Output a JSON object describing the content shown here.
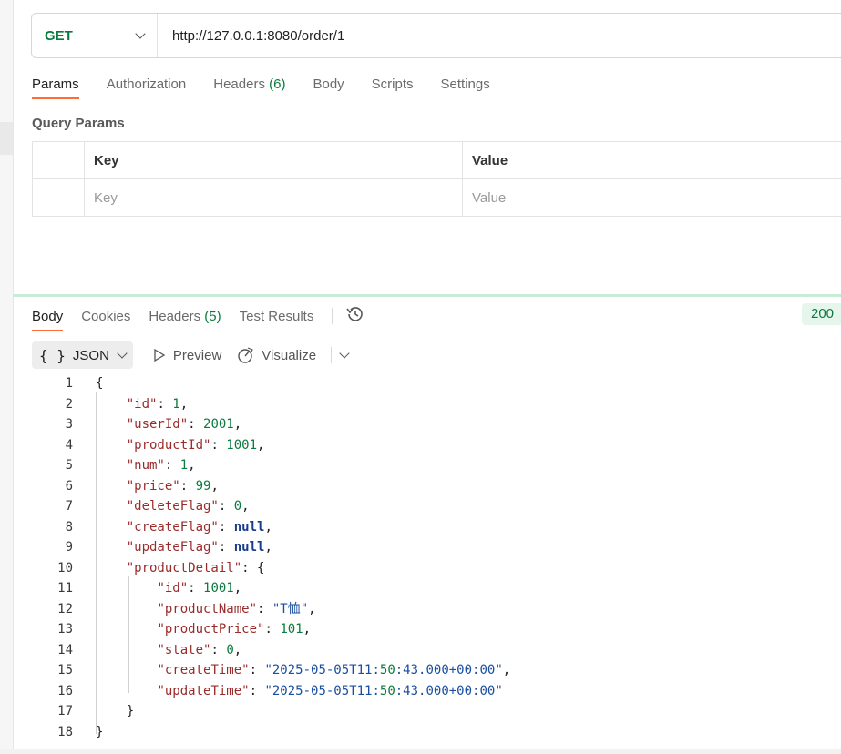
{
  "request": {
    "method": "GET",
    "url": "http://127.0.0.1:8080/order/1",
    "tabs": [
      {
        "label": "Params",
        "count": ""
      },
      {
        "label": "Authorization",
        "count": ""
      },
      {
        "label": "Headers",
        "count": "(6)"
      },
      {
        "label": "Body",
        "count": ""
      },
      {
        "label": "Scripts",
        "count": ""
      },
      {
        "label": "Settings",
        "count": ""
      }
    ],
    "query_params": {
      "title": "Query Params",
      "headers": [
        "Key",
        "Value"
      ],
      "placeholder_key": "Key",
      "placeholder_value": "Value"
    }
  },
  "response": {
    "tabs": [
      {
        "label": "Body",
        "count": ""
      },
      {
        "label": "Cookies",
        "count": ""
      },
      {
        "label": "Headers",
        "count": "(5)"
      },
      {
        "label": "Test Results",
        "count": ""
      }
    ],
    "status": "200",
    "format": "JSON",
    "preview_label": "Preview",
    "visualize_label": "Visualize",
    "code_lines": [
      "{",
      "    \"id\": 1,",
      "    \"userId\": 2001,",
      "    \"productId\": 1001,",
      "    \"num\": 1,",
      "    \"price\": 99,",
      "    \"deleteFlag\": 0,",
      "    \"createFlag\": null,",
      "    \"updateFlag\": null,",
      "    \"productDetail\": {",
      "        \"id\": 1001,",
      "        \"productName\": \"T恤\",",
      "        \"productPrice\": 101,",
      "        \"state\": 0,",
      "        \"createTime\": \"2025-05-05T11:50:43.000+00:00\",",
      "        \"updateTime\": \"2025-05-05T11:50:43.000+00:00\"",
      "    }",
      "}"
    ]
  },
  "colors": {
    "accent": "#ff6c37",
    "method_green": "#0b7a3e",
    "json_key": "#9a2b2b",
    "json_number": "#0b7a3e",
    "json_string": "#1a4fa0",
    "json_null": "#1a3c8c"
  },
  "icons": [
    "chevron-down-icon",
    "history-icon",
    "play-icon",
    "visualize-icon"
  ]
}
